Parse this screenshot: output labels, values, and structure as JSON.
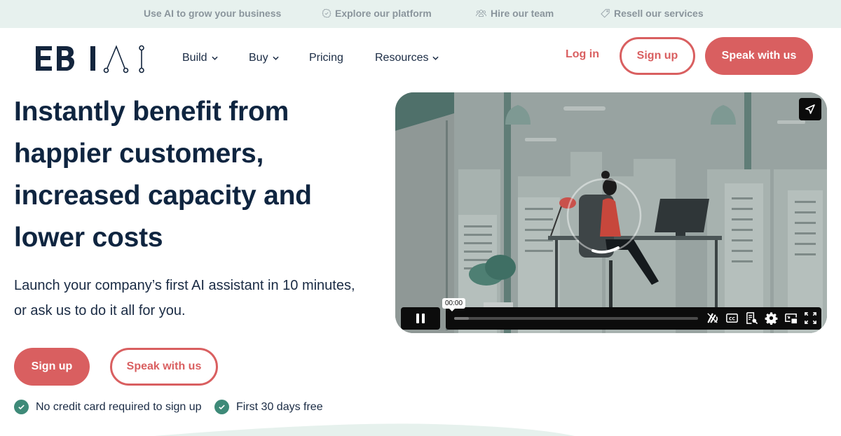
{
  "topbar": {
    "items": [
      {
        "label": "Use AI to grow your business",
        "icon": "none"
      },
      {
        "label": "Explore our platform",
        "icon": "badge-check-icon"
      },
      {
        "label": "Hire our team",
        "icon": "team-icon"
      },
      {
        "label": "Resell our services",
        "icon": "tag-icon"
      }
    ]
  },
  "header": {
    "logo_text": "EBI AI",
    "nav": [
      {
        "label": "Build",
        "has_dropdown": true
      },
      {
        "label": "Buy",
        "has_dropdown": true
      },
      {
        "label": "Pricing",
        "has_dropdown": false
      },
      {
        "label": "Resources",
        "has_dropdown": true
      }
    ],
    "login_label": "Log in",
    "signup_label": "Sign up",
    "speak_label": "Speak with us"
  },
  "hero": {
    "title_lines": [
      "Instantly benefit from",
      "happier customers,",
      "increased capacity and",
      "lower costs"
    ],
    "subtitle_lines": [
      "Launch your company’s first AI assistant in 10 minutes,",
      "or ask us to do it all for you."
    ],
    "signup_label": "Sign up",
    "speak_label": "Speak with us",
    "perks": [
      "No credit card required to sign up",
      "First 30 days free"
    ]
  },
  "video": {
    "current_time": "00:00",
    "progress": 0.02,
    "state": "playing",
    "controls": [
      "speed-off-icon",
      "captions-icon",
      "transcript-search-icon",
      "settings-icon",
      "picture-in-picture-icon",
      "fullscreen-icon"
    ]
  },
  "colors": {
    "accent": "#d95f60",
    "navy": "#0f2540",
    "topbar_bg": "#e7f1ee",
    "check_green": "#3e8a78"
  }
}
